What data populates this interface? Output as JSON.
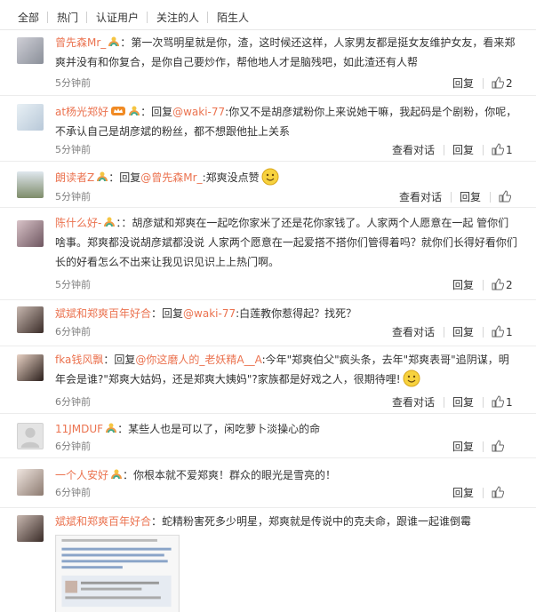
{
  "filter": {
    "tabs": [
      "全部",
      "热门",
      "认证用户",
      "关注的人",
      "陌生人"
    ]
  },
  "labels": {
    "reply": "回复",
    "view_conversation": "查看对话",
    "reply_prefix": "回复",
    "colon": "："
  },
  "comments": [
    {
      "user": "曾先森Mr_",
      "badges": [
        "rainbow"
      ],
      "text": "第一次骂明星就是你，渣，这时候还这样，人家男友都是挺女友维护女友，看来郑爽并没有和你复合，是你自己要炒作，帮他地人才是脑残吧，如此渣还有人帮",
      "time": "5分钟前",
      "like_count": "2",
      "has_conversation": false
    },
    {
      "user": "at杨光郑好",
      "badges": [
        "vip",
        "rainbow"
      ],
      "reply_to": "@waki-77",
      "text": ":你又不是胡彦斌粉你上来说她干嘛，我起码是个剧粉，你呢，不承认自己是胡彦斌的粉丝，都不想跟他扯上关系",
      "time": "5分钟前",
      "like_count": "1",
      "has_conversation": true
    },
    {
      "user": "朗读者Z",
      "badges": [
        "rainbow"
      ],
      "reply_to": "@曾先森Mr_",
      "text": ":郑爽没点赞",
      "emoji": "smile",
      "time": "5分钟前",
      "like_count": "",
      "has_conversation": true
    },
    {
      "user": "陈什么好-",
      "badges": [
        "rainbow"
      ],
      "text": "：胡彦斌和郑爽在一起吃你家米了还是花你家钱了。人家两个人愿意在一起 管你们啥事。郑爽都没说胡彦斌都没说 人家两个愿意在一起爱搭不搭你们管得着吗？就你们长得好看你们长的好看怎么不出来让我见识见识上上热门啊。",
      "time": "5分钟前",
      "like_count": "2",
      "has_conversation": false
    },
    {
      "user": "斌斌和郑爽百年好合",
      "badges": [],
      "reply_to": "@waki-77",
      "text": ":白莲教你惹得起？找死？",
      "time": "6分钟前",
      "like_count": "1",
      "has_conversation": true
    },
    {
      "user": "fka钱风飘",
      "badges": [],
      "reply_to": "@你这磨人的_老妖精A__A",
      "text": ":今年\"郑爽伯父\"疯头条，去年\"郑爽表哥\"追阴谋，明年会是谁?\"郑爽大姑妈，还是郑爽大姨妈\"?家族都是好戏之人，很期待哩!",
      "emoji": "smile",
      "time": "6分钟前",
      "like_count": "1",
      "has_conversation": true
    },
    {
      "user": "11JMDUF",
      "badges": [
        "rainbow"
      ],
      "text": "某些人也是可以了，闲吃萝卜淡操心的命",
      "time": "6分钟前",
      "like_count": "",
      "has_conversation": false
    },
    {
      "user": "一个人安好",
      "badges": [
        "rainbow"
      ],
      "text": "你根本就不爱郑爽！群众的眼光是雪亮的！",
      "time": "6分钟前",
      "like_count": "",
      "has_conversation": false
    },
    {
      "user": "斌斌和郑爽百年好合",
      "badges": [],
      "text": "蛇精粉害死多少明星，郑爽就是传说中的克夫命，跟谁一起谁倒霉",
      "time": "",
      "like_count": "",
      "has_conversation": false,
      "has_image": true
    }
  ],
  "colors": {
    "accent": "#eb7350",
    "text": "#333333",
    "muted": "#808080"
  }
}
